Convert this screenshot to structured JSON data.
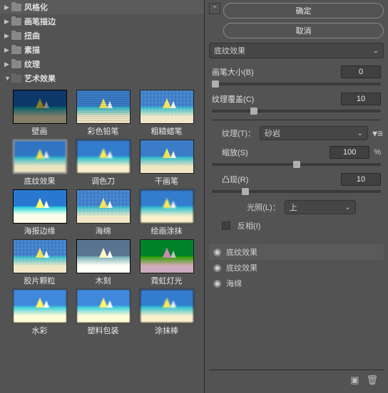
{
  "categories": [
    {
      "label": "风格化",
      "expanded": false
    },
    {
      "label": "画笔描边",
      "expanded": false
    },
    {
      "label": "扭曲",
      "expanded": false
    },
    {
      "label": "素描",
      "expanded": false
    },
    {
      "label": "纹理",
      "expanded": false
    },
    {
      "label": "艺术效果",
      "expanded": true
    }
  ],
  "thumbs": [
    {
      "label": "壁画"
    },
    {
      "label": "彩色铅笔"
    },
    {
      "label": "粗糙蜡笔"
    },
    {
      "label": "底纹效果",
      "selected": true
    },
    {
      "label": "调色刀"
    },
    {
      "label": "干画笔"
    },
    {
      "label": "海报边缘"
    },
    {
      "label": "海绵"
    },
    {
      "label": "绘画涂抹"
    },
    {
      "label": "胶片颗粒"
    },
    {
      "label": "木刻"
    },
    {
      "label": "霓虹灯光"
    },
    {
      "label": "水彩"
    },
    {
      "label": "塑料包装"
    },
    {
      "label": "涂抹棒"
    }
  ],
  "buttons": {
    "ok": "确定",
    "cancel": "取消"
  },
  "filter_dropdown": "底纹效果",
  "controls": {
    "brush_size_label": "画笔大小(B)",
    "brush_size_value": "0",
    "texture_coverage_label": "纹理覆盖(C)",
    "texture_coverage_value": "10",
    "texture_label": "纹理(T)：",
    "texture_value": "砂岩",
    "scale_label": "缩放(S)",
    "scale_value": "100",
    "scale_unit": "%",
    "relief_label": "凸现(R)",
    "relief_value": "10",
    "light_label": "光照(L)：",
    "light_value": "上",
    "invert_label": "反相(I)"
  },
  "layers": [
    {
      "visible": true,
      "name": "底纹效果",
      "selected": true
    },
    {
      "visible": true,
      "name": "底纹效果"
    },
    {
      "visible": true,
      "name": "海绵"
    }
  ]
}
